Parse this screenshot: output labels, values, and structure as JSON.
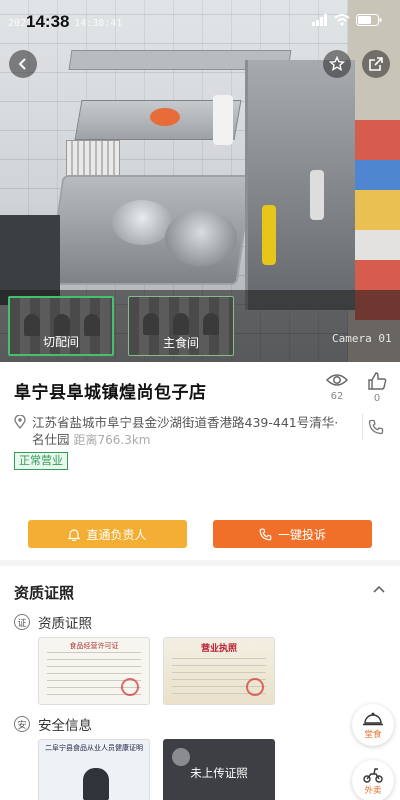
{
  "status_bar": {
    "time": "14:38",
    "camera_timestamp": "2021-11-22 14:38:41"
  },
  "camera": {
    "overlay_label": "Camera 01",
    "views": [
      {
        "label": "切配间",
        "selected": true
      },
      {
        "label": "主食间",
        "selected": false
      }
    ]
  },
  "shop": {
    "name": "阜宁县阜城镇煌尚包子店",
    "views_count": "62",
    "likes_count": "0",
    "address": "江苏省盐城市阜宁县金沙湖街道香港路439-441号清华·名仕园",
    "distance": "距离766.3km",
    "status": "正常营业"
  },
  "actions": {
    "contact_label": "直通负责人",
    "complain_label": "一键投诉"
  },
  "qualifications": {
    "title": "资质证照",
    "cert_group": {
      "badge": "证",
      "label": "资质证照",
      "doc1_header": "食品经营许可证",
      "doc2_header": "营业执照"
    },
    "safety_group": {
      "badge": "安",
      "label": "安全信息",
      "doc1_header": "二阜宁县食品从业人员健康证明",
      "pending_label": "未上传证照"
    }
  },
  "fabs": {
    "dine_in": "堂食",
    "takeout": "外卖"
  },
  "colors": {
    "status_green": "#2e9e56",
    "contact_yellow": "#f3ae33",
    "complain_orange": "#f0702a"
  }
}
